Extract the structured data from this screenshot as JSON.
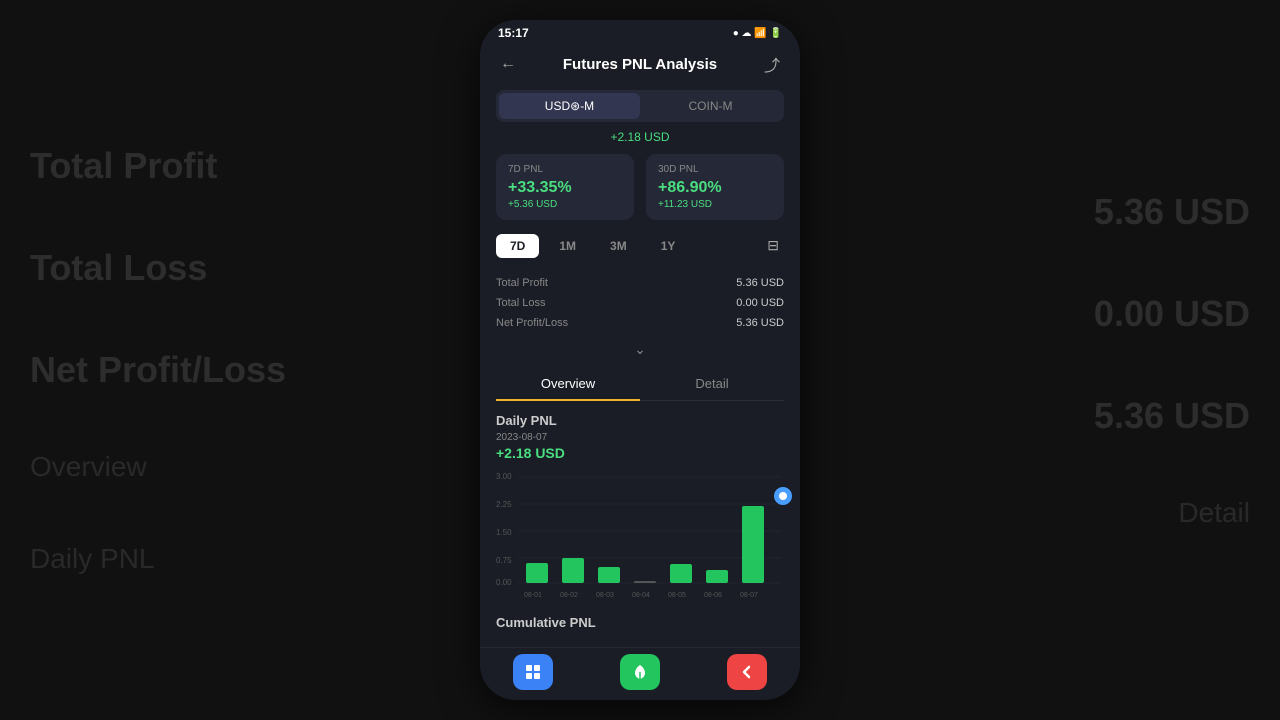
{
  "background": {
    "left_labels": [
      "Total Profit",
      "Total Loss",
      "Net Profit/Loss"
    ],
    "right_values": [
      "5.36 USD",
      "0.00 USD",
      "5.36 USD"
    ],
    "bottom_labels": [
      "Overview",
      "Daily PNL"
    ],
    "bottom_right_labels": [
      "Detail"
    ]
  },
  "status_bar": {
    "time": "15:17",
    "icons": "● ☁ 📶"
  },
  "header": {
    "title": "Futures PNL Analysis",
    "back_icon": "←",
    "share_icon": "⤴"
  },
  "currency_tabs": [
    {
      "label": "USD⊛-M",
      "active": true
    },
    {
      "label": "COIN-M",
      "active": false
    }
  ],
  "header_value": "+2.18 USD",
  "pnl_cards": [
    {
      "label": "7D PNL",
      "percent": "+33.35%",
      "usd": "+5.36 USD"
    },
    {
      "label": "30D PNL",
      "percent": "+86.90%",
      "usd": "+11.23 USD"
    }
  ],
  "period_tabs": [
    {
      "label": "7D",
      "active": true
    },
    {
      "label": "1M",
      "active": false
    },
    {
      "label": "3M",
      "active": false
    },
    {
      "label": "1Y",
      "active": false
    }
  ],
  "stats": [
    {
      "label": "Total Profit",
      "value": "5.36 USD"
    },
    {
      "label": "Total Loss",
      "value": "0.00 USD"
    },
    {
      "label": "Net Profit/Loss",
      "value": "5.36 USD"
    }
  ],
  "view_tabs": [
    {
      "label": "Overview",
      "active": true
    },
    {
      "label": "Detail",
      "active": false
    }
  ],
  "daily_pnl": {
    "title": "Daily PNL",
    "date": "2023-08-07",
    "value": "+2.18 USD"
  },
  "chart": {
    "y_labels": [
      "3.00",
      "2.25",
      "1.50",
      "0.75",
      "0.00"
    ],
    "x_labels": [
      "08-01",
      "08-02",
      "08-03",
      "08-04",
      "08-05",
      "08-06",
      "08-07"
    ],
    "bars": [
      0.55,
      0.7,
      0.45,
      0.0,
      0.52,
      0.35,
      2.18
    ]
  },
  "cumulative_title": "Cumulative PNL",
  "bottom_nav": [
    {
      "icon": "grid",
      "color": "blue"
    },
    {
      "icon": "leaf",
      "color": "green"
    },
    {
      "icon": "chevron-left",
      "color": "red"
    }
  ]
}
